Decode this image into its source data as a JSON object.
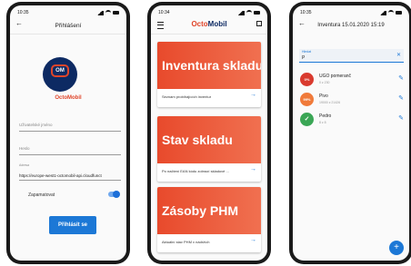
{
  "phone1": {
    "time": "10:35",
    "title": "Přihlášení",
    "logo_badge": "OM",
    "logo_text": "OctoMobil",
    "username_placeholder": "Uživatelské jméno",
    "password_placeholder": "Heslo",
    "server_label": "Adresa",
    "server_value": "https://europe-west1-octomobil-api.cloudfunct",
    "remember_label": "Zapamatovat",
    "login_button": "Přihlásit se"
  },
  "phone2": {
    "time": "10:34",
    "brand_octo": "Octo",
    "brand_mobil": "Mobil",
    "cards": [
      {
        "title": "Inventura skladu",
        "subtitle": "Seznam probíhajících inventur"
      },
      {
        "title": "Stav skladu",
        "subtitle": "Po načtení EAN kódu zobrazí skladové ..."
      },
      {
        "title": "Zásoby PHM",
        "subtitle": "Aktuální stav PHM v nádržích"
      }
    ]
  },
  "phone3": {
    "time": "10:35",
    "title": "Inventura 15.01.2020 15:19",
    "search_label": "Hledat",
    "search_value": "P",
    "items": [
      {
        "badge": "0%",
        "name": "UGO pomeranč",
        "detail": "0 z 230",
        "color": "#d93a2e"
      },
      {
        "badge": "99%",
        "name": "Pivo",
        "detail": "19000 z 21426",
        "color": "#f07a3a"
      },
      {
        "badge": "✓",
        "name": "Pedro",
        "detail": "8 z 8",
        "color": "#3aa655"
      }
    ],
    "fab": "+"
  }
}
